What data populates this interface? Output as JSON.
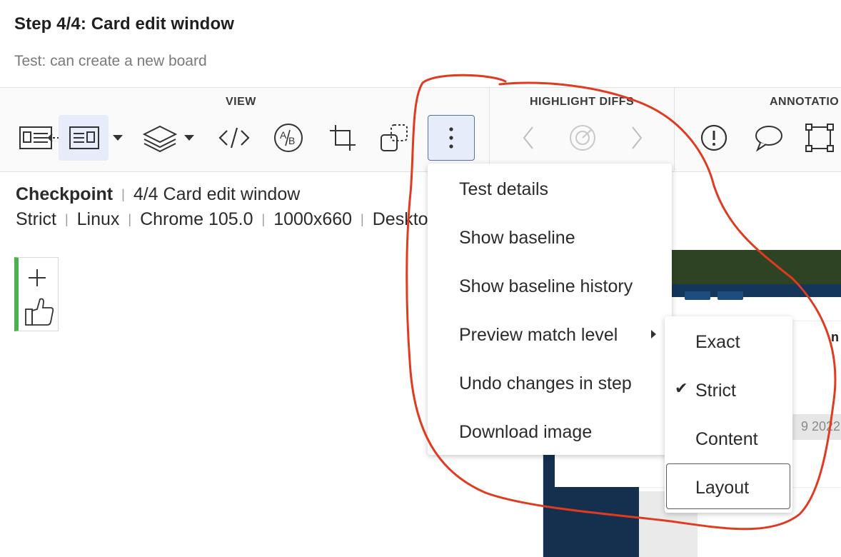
{
  "header": {
    "step_title": "Step 4/4:  Card edit window",
    "test_name": "Test: can create a new board"
  },
  "toolbar": {
    "sections": {
      "view": "VIEW",
      "highlight_diffs": "HIGHLIGHT DIFFS",
      "annotations": "ANNOTATIO"
    },
    "buttons": {
      "side_by_side": "side-by-side-icon",
      "single_view": "single-view-icon",
      "layers": "layers-icon",
      "code": "code-icon",
      "ab_compare": "ab-compare-icon",
      "crop": "crop-icon",
      "overlap": "overlap-regions-icon",
      "more": "more-vertical-icon",
      "prev_diff": "chevron-left-icon",
      "diff_target": "target-icon",
      "next_diff": "chevron-right-icon",
      "issue": "exclamation-icon",
      "remark": "speech-bubble-icon",
      "region": "region-select-icon"
    }
  },
  "checkpoint": {
    "label": "Checkpoint",
    "name": "4/4 Card edit window",
    "match_level": "Strict",
    "os": "Linux",
    "browser": "Chrome 105.0",
    "viewport": "1000x660",
    "device": "Deskto"
  },
  "side_actions": {
    "add": "plus-icon",
    "approve": "thumbs-up-icon"
  },
  "menu": {
    "items": [
      "Test details",
      "Show baseline",
      "Show baseline history",
      "Preview match level",
      "Undo changes in step",
      "Download image"
    ]
  },
  "submenu": {
    "items": [
      "Exact",
      "Strict",
      "Content",
      "Layout"
    ],
    "selected": "Strict",
    "hovered": "Layout"
  },
  "preview": {
    "title_fragment": "n",
    "date_fragment": "9 2022"
  },
  "colors": {
    "annotation_red": "#e03a20",
    "selected_bg": "#e6ecf9",
    "approve_green": "#4caf50"
  }
}
